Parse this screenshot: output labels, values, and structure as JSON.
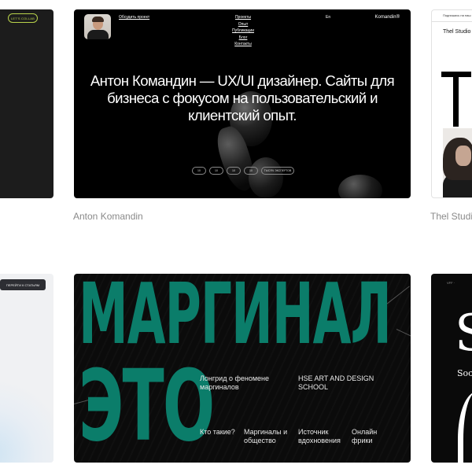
{
  "cards": {
    "left_top": {
      "button_label": "LET'S COLLAB"
    },
    "left_bottom": {
      "button_label": "ПЕРЕЙТИ К СТАТЬЯМ"
    },
    "anton": {
      "caption": "Anton Komandin",
      "discuss_link": "Обсудить проект",
      "menu": [
        "Проекты",
        "Опыт",
        "Публикации",
        "Блог",
        "Контакты"
      ],
      "lang": "En",
      "logo": "Komandin®",
      "headline": "Антон Командин — UX/UI дизайнер. Сайты для бизнеса с фокусом на пользовательский и клиентский опыт.",
      "chips": [
        "10",
        "10",
        "10",
        "10",
        "ТЫСЯЧ ЭКСПЕРТОВ"
      ]
    },
    "thel": {
      "caption": "Thel Studio",
      "topline": "Подпишись на наш",
      "title": "Thel Studio",
      "big_letter": "T"
    },
    "marginal": {
      "big_word_1": "МАРГИНАЛ",
      "big_word_2": "ЭТО",
      "longread": "Лонгрид о феномене маргиналов",
      "school": "HSE ART AND DESIGN SCHOOL",
      "links": [
        "Кто такие?",
        "Маргиналы и общество",
        "Источник вдохновения",
        "Онлайн фрики"
      ]
    },
    "s_card": {
      "topline": "VFF ·",
      "big_letter": "S",
      "subtitle": "Soc"
    }
  },
  "colors": {
    "marginal_green": "#0b7d6a",
    "collab_lime": "#b8d24a",
    "caption_gray": "#8a8a8a"
  }
}
